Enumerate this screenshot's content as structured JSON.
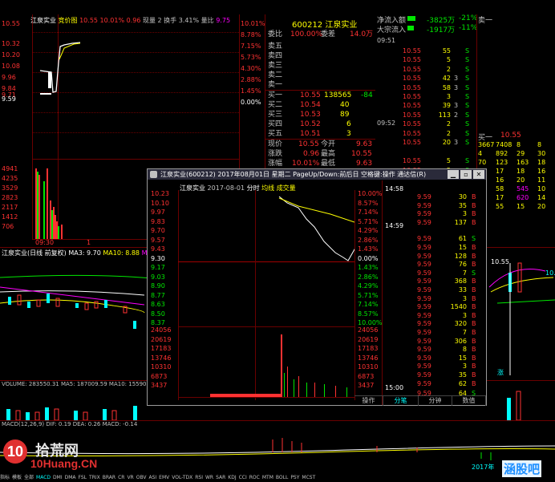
{
  "main_chart": {
    "header_name": "江泉实业",
    "header_mode": "竞价图",
    "header_price": "10.55",
    "header_pct": "10.01%",
    "header_change": "0.96",
    "header_vol_label": "现量 2",
    "header_turnover": "换手 3.41%",
    "header_ratio_label": "量比",
    "header_ratio": "9.75",
    "left_prices": [
      "10.55",
      "10.32",
      "10.20",
      "10.08",
      "9.96",
      "9.84",
      "9.71",
      "9.59"
    ],
    "right_pcts": [
      "10.01%",
      "8.78%",
      "7.15%",
      "5.73%",
      "4.30%",
      "2.88%",
      "1.45%",
      "0.00%"
    ],
    "left_vol": [
      "4941",
      "4235",
      "3529",
      "2823",
      "2117",
      "1412",
      "706"
    ],
    "left_labels_lower": [
      "09:30",
      "1"
    ]
  },
  "order_book": {
    "code": "600212",
    "name": "江泉实业",
    "weibi_label": "委比",
    "weibi_value": "100.00%",
    "weicha_label": "委差",
    "weicha_value": "14.0万",
    "sells": [
      {
        "label": "卖五",
        "price": "",
        "vol": ""
      },
      {
        "label": "卖四",
        "price": "",
        "vol": ""
      },
      {
        "label": "卖三",
        "price": "",
        "vol": ""
      },
      {
        "label": "卖二",
        "price": "",
        "vol": ""
      },
      {
        "label": "卖一",
        "price": "",
        "vol": ""
      }
    ],
    "buys": [
      {
        "label": "买一",
        "price": "10.55",
        "vol": "138565",
        "chg": "-84"
      },
      {
        "label": "买二",
        "price": "10.54",
        "vol": "40",
        "chg": ""
      },
      {
        "label": "买三",
        "price": "10.53",
        "vol": "89",
        "chg": ""
      },
      {
        "label": "买四",
        "price": "10.52",
        "vol": "6",
        "chg": ""
      },
      {
        "label": "买五",
        "price": "10.51",
        "vol": "3",
        "chg": ""
      }
    ],
    "stats": [
      {
        "l1": "现价",
        "v1": "10.55",
        "l2": "今开",
        "v2": "9.63"
      },
      {
        "l1": "涨跌",
        "v1": "0.96",
        "l2": "最高",
        "v2": "10.55"
      },
      {
        "l1": "涨幅",
        "v1": "10.01%",
        "l2": "最低",
        "v2": "9.63"
      }
    ]
  },
  "flow": {
    "net_label": "净流入额",
    "net_value": "-3825万",
    "net_pct": "-21%",
    "big_label": "大宗流入",
    "big_value": "-1917万",
    "big_pct": "-11%",
    "sell1_label": "卖一"
  },
  "ticks_right": {
    "time1": "09:51",
    "time2": "09:52",
    "rows": [
      {
        "p": "10.55",
        "v": "55",
        "f": "S"
      },
      {
        "p": "10.55",
        "v": "5",
        "f": "S"
      },
      {
        "p": "10.55",
        "v": "2",
        "f": "S"
      },
      {
        "p": "10.55",
        "v": "42",
        "s": "3",
        "f": "S"
      },
      {
        "p": "10.55",
        "v": "58",
        "s": "3",
        "f": "S"
      },
      {
        "p": "10.55",
        "v": "3",
        "f": "S"
      },
      {
        "p": "10.55",
        "v": "39",
        "s": "3",
        "f": "S"
      },
      {
        "p": "10.55",
        "v": "113",
        "s": "2",
        "f": "S"
      },
      {
        "p": "10.55",
        "v": "2",
        "f": "S"
      },
      {
        "p": "10.55",
        "v": "2",
        "f": "S"
      },
      {
        "p": "10.55",
        "v": "20",
        "s": "3",
        "f": "S"
      },
      {
        "p": "10.55",
        "v": "5",
        "f": "S"
      },
      {
        "p": "10.55",
        "v": "5",
        "f": "S"
      },
      {
        "p": "10.55",
        "v": "1",
        "f": "S"
      }
    ]
  },
  "queue_panel": {
    "label": "买一",
    "price": "10.55",
    "rows": [
      [
        "3667",
        "7408",
        "8",
        "8"
      ],
      [
        "4",
        "892",
        "29",
        "30"
      ],
      [
        "70",
        "123",
        "163",
        "18"
      ],
      [
        "1",
        "17",
        "18",
        "16"
      ],
      [
        "1",
        "16",
        "20",
        "11"
      ],
      [
        "29",
        "58",
        "545",
        "10"
      ],
      [
        "5",
        "17",
        "620",
        "14"
      ],
      [
        "1",
        "55",
        "15",
        "20"
      ]
    ]
  },
  "daily": {
    "title": "江泉实业(日线 前复权)",
    "ma3": "MA3: 9.70",
    "ma10": "MA10: 8.88",
    "ma20": "MA20",
    "price_hi": "10.55",
    "price_right": "10.",
    "volume_line": "VOLUME: 283550.31  MA5: 187009.59  MA10: 15590",
    "macd_line": "MACD(12,26,9)  DIF: 0.19  DEA: 0.26  MACD: -0.14",
    "date_tag": "2017年",
    "marker": "涨"
  },
  "popup": {
    "title": "江泉实业(600212) 2017年08月01日 星期二 PageUp/Down:前后日 空格键:操作 通达信(R)",
    "inner_name": "江泉实业",
    "inner_date": "2017-08-01",
    "inner_tab1": "分时",
    "inner_tab2": "均线",
    "inner_tab3": "成交量",
    "left_prices": [
      "10.23",
      "10.10",
      "9.97",
      "9.83",
      "9.70",
      "9.57",
      "9.43",
      "9.30",
      "9.17",
      "9.03",
      "8.90",
      "8.77",
      "8.63",
      "8.50",
      "8.37"
    ],
    "right_pcts": [
      "10.00%",
      "8.57%",
      "7.14%",
      "5.71%",
      "4.29%",
      "2.86%",
      "1.43%",
      "0.00%",
      "1.43%",
      "2.86%",
      "4.29%",
      "5.71%",
      "7.14%",
      "8.57%",
      "10.00%"
    ],
    "vol_labels": [
      "24056",
      "20619",
      "17183",
      "13746",
      "10310",
      "6873",
      "3437"
    ],
    "t1": "14:58",
    "t2": "14:59",
    "t3": "15:00",
    "rows": [
      {
        "p": "9.59",
        "v": "30",
        "f": "B"
      },
      {
        "p": "9.59",
        "v": "35",
        "f": "B"
      },
      {
        "p": "9.59",
        "v": "3",
        "f": "B"
      },
      {
        "p": "9.59",
        "v": "137",
        "f": "B"
      },
      {
        "p": "9.59",
        "v": "61",
        "f": "S"
      },
      {
        "p": "9.59",
        "v": "15",
        "f": "B"
      },
      {
        "p": "9.59",
        "v": "128",
        "f": "B"
      },
      {
        "p": "9.59",
        "v": "76",
        "f": "B"
      },
      {
        "p": "9.59",
        "v": "7",
        "f": "S"
      },
      {
        "p": "9.59",
        "v": "368",
        "f": "B"
      },
      {
        "p": "9.59",
        "v": "33",
        "f": "B"
      },
      {
        "p": "9.59",
        "v": "3",
        "f": "B"
      },
      {
        "p": "9.59",
        "v": "1540",
        "f": "B"
      },
      {
        "p": "9.59",
        "v": "3",
        "f": "B"
      },
      {
        "p": "9.59",
        "v": "320",
        "f": "B"
      },
      {
        "p": "9.59",
        "v": "7",
        "f": "B"
      },
      {
        "p": "9.59",
        "v": "306",
        "f": "B"
      },
      {
        "p": "9.59",
        "v": "8",
        "f": "B"
      },
      {
        "p": "9.59",
        "v": "15",
        "f": "B"
      },
      {
        "p": "9.59",
        "v": "3",
        "f": "B"
      },
      {
        "p": "9.59",
        "v": "35",
        "f": "B"
      },
      {
        "p": "9.59",
        "v": "62",
        "f": "B"
      },
      {
        "p": "9.59",
        "v": "64",
        "f": "S"
      }
    ],
    "btn_ops": "操作",
    "btn_fen": "分笔",
    "btn_min": "分钟",
    "btn_data": "数值"
  },
  "bottom_bar": [
    "指标",
    "模板",
    "全部",
    "MACD",
    "DMI",
    "DMA",
    "FSL",
    "TRIX",
    "BRAR",
    "CR",
    "VR",
    "OBV",
    "ASI",
    "EMV",
    "VOL-TDX",
    "RSI",
    "WR",
    "SAR",
    "KDJ",
    "CCI",
    "ROC",
    "MTM",
    "BOLL",
    "PSY",
    "MCST"
  ],
  "watermark_left": "10",
  "watermark_mid": "拾荒网",
  "watermark_site": "10Huang.CN",
  "watermark_right": "涵股吧",
  "colors": {
    "up": "#ff3232",
    "down": "#00e600",
    "grid": "#6a0000",
    "yellow": "#ffff00"
  }
}
